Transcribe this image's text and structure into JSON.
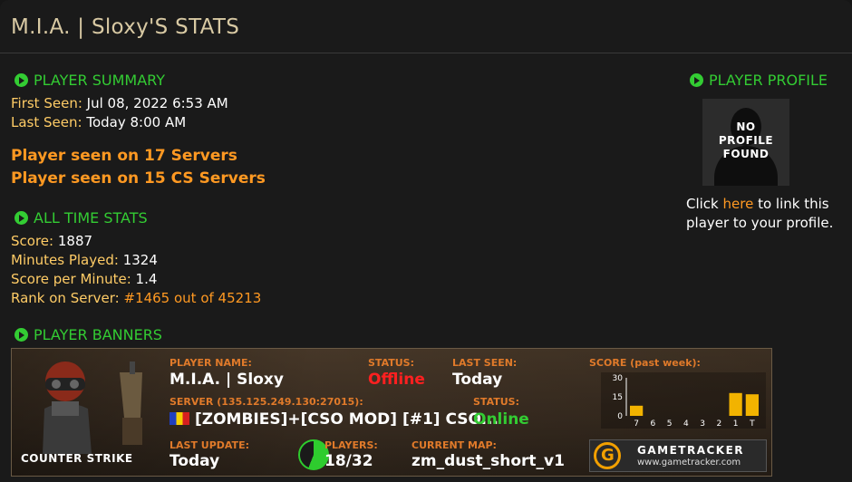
{
  "page": {
    "title": "M.I.A. | Sloxy'S STATS"
  },
  "summary": {
    "heading": "PLAYER SUMMARY",
    "first_seen_label": "First Seen:",
    "first_seen_value": "Jul 08, 2022 6:53 AM",
    "last_seen_label": "Last Seen:",
    "last_seen_value": "Today 8:00 AM",
    "servers_line": "Player seen on 17 Servers",
    "cs_servers_line": "Player seen on 15 CS Servers"
  },
  "stats": {
    "heading": "ALL TIME STATS",
    "score_label": "Score:",
    "score_value": "1887",
    "minutes_label": "Minutes Played:",
    "minutes_value": "1324",
    "spm_label": "Score per Minute:",
    "spm_value": "1.4",
    "rank_label": "Rank on Server:",
    "rank_value": "#1465 out of 45213"
  },
  "profile": {
    "heading": "PLAYER PROFILE",
    "avatar_text_1": "NO",
    "avatar_text_2": "PROFILE",
    "avatar_text_3": "FOUND",
    "text_prefix": "Click ",
    "link": "here",
    "text_suffix": " to link this",
    "text_line2": "player to your profile."
  },
  "banners": {
    "heading": "PLAYER BANNERS",
    "game_logo": "COUNTER STRIKE",
    "player_name_label": "PLAYER NAME:",
    "player_name": "M.I.A. | Sloxy",
    "status_label": "STATUS:",
    "status_value": "Offline",
    "last_seen_label": "LAST SEEN:",
    "last_seen_value": "Today",
    "server_label": "SERVER (135.125.249.130:27015):",
    "server_name": "[ZOMBIES]+[CSO MOD] [#1] CSO...",
    "server_status_label": "STATUS:",
    "server_status_value": "Online",
    "last_update_label": "LAST UPDATE:",
    "last_update_value": "Today",
    "players_label": "PLAYERS:",
    "players_value": "18/32",
    "players_fill": 0.5625,
    "map_label": "CURRENT MAP:",
    "map_value": "zm_dust_short_v1",
    "score_label": "SCORE (past week):",
    "tracker_name": "GAMETRACKER",
    "tracker_url": "www.gametracker.com",
    "accent_color": "#e07a2a",
    "offline_color": "#ff2020",
    "online_color": "#33cc33"
  },
  "chart_data": {
    "type": "bar",
    "title": "SCORE (past week):",
    "categories": [
      "7",
      "6",
      "5",
      "4",
      "3",
      "2",
      "1",
      "T"
    ],
    "values": [
      8,
      0,
      0,
      0,
      0,
      0,
      18,
      17
    ],
    "yticks": [
      "30",
      "15",
      "0"
    ],
    "ylim": [
      0,
      30
    ],
    "bar_color": "#f2b300"
  }
}
